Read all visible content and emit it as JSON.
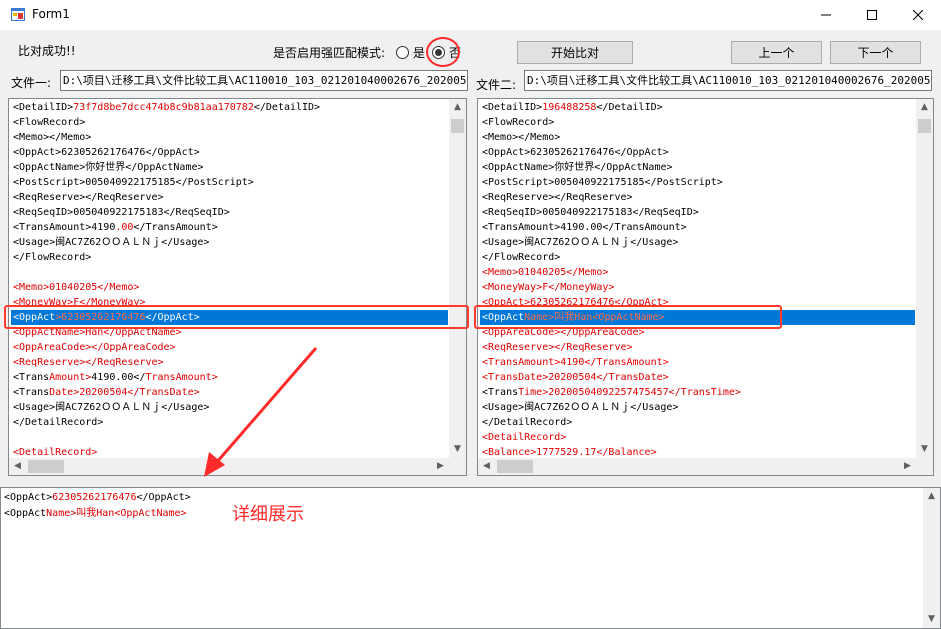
{
  "window": {
    "title": "Form1"
  },
  "status": {
    "message": "比对成功!!"
  },
  "mode": {
    "label": "是否启用强匹配模式:",
    "yes_label": "是",
    "no_label": "否",
    "selected": "否"
  },
  "buttons": {
    "start": "开始比对",
    "prev": "上一个",
    "next": "下一个"
  },
  "file1": {
    "label": "文件一:",
    "path": "D:\\项目\\迁移工具\\文件比较工具\\AC110010_103_021201040002676_20200504"
  },
  "file2": {
    "label": "文件二:",
    "path": "D:\\项目\\迁移工具\\文件比较工具\\AC110010_103_021201040002676_20200504"
  },
  "left_pane": {
    "selected_index": 14,
    "lines": [
      [
        {
          "t": "<DetailID>"
        },
        {
          "t": "73f7d8be7dcc474b8c9b81aa170782",
          "r": true
        },
        {
          "t": "</DetailID>"
        }
      ],
      [
        {
          "t": "<FlowRecord>"
        }
      ],
      [
        {
          "t": "<Memo></Memo>"
        }
      ],
      [
        {
          "t": "<OppAct>62305262176476</OppAct>"
        }
      ],
      [
        {
          "t": "<OppActName>你好世界</OppActName>"
        }
      ],
      [
        {
          "t": "<PostScript>005040922175185</PostScript>"
        }
      ],
      [
        {
          "t": "<ReqReserve></ReqReserve>"
        }
      ],
      [
        {
          "t": "<ReqSeqID>005040922175183</ReqSeqID>"
        }
      ],
      [
        {
          "t": "<TransAmount>4190"
        },
        {
          "t": ".00",
          "r": true
        },
        {
          "t": "</TransAmount>"
        }
      ],
      [
        {
          "t": "<Usage>闽AC7Z62ＯＯＡＬＮｊ</Usage>"
        }
      ],
      [
        {
          "t": "</FlowRecord>"
        }
      ],
      [
        {
          "t": ""
        }
      ],
      [
        {
          "t": "<Memo>01040205</Memo>",
          "r": true
        }
      ],
      [
        {
          "t": "<MoneyWay>F</MoneyWay>",
          "r": true
        }
      ],
      [
        {
          "t": "<OppAct"
        },
        {
          "t": ">62305262176476",
          "r": true
        },
        {
          "t": "</OppAct>"
        }
      ],
      [
        {
          "t": "<OppActName>Han</OppActName>",
          "r": true
        }
      ],
      [
        {
          "t": "<OppAreaCode></OppAreaCode>",
          "r": true
        }
      ],
      [
        {
          "t": "<ReqReserve></ReqReserve>",
          "r": true
        }
      ],
      [
        {
          "t": "<Trans"
        },
        {
          "t": "Amount>",
          "r": true
        },
        {
          "t": "4190.00</"
        },
        {
          "t": "TransAmount>",
          "r": true
        }
      ],
      [
        {
          "t": "<Trans"
        },
        {
          "t": "Date>20200504</TransDate>",
          "r": true
        }
      ],
      [
        {
          "t": "<Usage>闽AC7Z62ＯＯＡＬＮｊ</Usage>"
        }
      ],
      [
        {
          "t": "</DetailRecord>"
        }
      ],
      [
        {
          "t": ""
        }
      ],
      [
        {
          "t": "<DetailRecord>",
          "r": true
        }
      ]
    ]
  },
  "right_pane": {
    "selected_index": 14,
    "lines": [
      [
        {
          "t": "<DetailID>"
        },
        {
          "t": "196488258",
          "r": true
        },
        {
          "t": "</DetailID>"
        }
      ],
      [
        {
          "t": "<FlowRecord>"
        }
      ],
      [
        {
          "t": "<Memo></Memo>"
        }
      ],
      [
        {
          "t": "<OppAct>62305262176476</OppAct>"
        }
      ],
      [
        {
          "t": "<OppActName>你好世界</OppActName>"
        }
      ],
      [
        {
          "t": "<PostScript>005040922175185</PostScript>"
        }
      ],
      [
        {
          "t": "<ReqReserve></ReqReserve>"
        }
      ],
      [
        {
          "t": "<ReqSeqID>005040922175183</ReqSeqID>"
        }
      ],
      [
        {
          "t": "<TransAmount>4190.00</TransAmount>"
        }
      ],
      [
        {
          "t": "<Usage>闽AC7Z62ＯＯＡＬＮｊ</Usage>"
        }
      ],
      [
        {
          "t": "</FlowRecord>"
        }
      ],
      [
        {
          "t": "<Memo>01040205</Memo>",
          "r": true
        }
      ],
      [
        {
          "t": "<MoneyWay>F</MoneyWay>",
          "r": true
        }
      ],
      [
        {
          "t": "<OppAct>62305262176476</OppAct>",
          "r": true
        }
      ],
      [
        {
          "t": "<OppAct"
        },
        {
          "t": "Name>叫我Han<OppActName>",
          "r": true
        }
      ],
      [
        {
          "t": "<OppAreaCode></OppAreaCode>",
          "r": true
        }
      ],
      [
        {
          "t": "<ReqReserve></ReqReserve>",
          "r": true
        }
      ],
      [
        {
          "t": "<TransAmount>4190</TransAmount>",
          "r": true
        }
      ],
      [
        {
          "t": "<TransDate>20200504</TransDate>",
          "r": true
        }
      ],
      [
        {
          "t": "<Trans"
        },
        {
          "t": "Time>20200504092257475457</TransTime>",
          "r": true
        }
      ],
      [
        {
          "t": "<Usage>闽AC7Z62ＯＯＡＬＮｊ</Usage>"
        }
      ],
      [
        {
          "t": "</DetailRecord>"
        }
      ],
      [
        {
          "t": "<DetailRecord>",
          "r": true
        }
      ],
      [
        {
          "t": "<Balance>1777529.17</Balance>",
          "r": true
        }
      ]
    ]
  },
  "detail": {
    "lines": [
      [
        {
          "t": "<OppAct>"
        },
        {
          "t": "62305262176476",
          "r": true
        },
        {
          "t": "</OppAct>"
        }
      ],
      [
        {
          "t": "<OppAct"
        },
        {
          "t": "Name>叫我Han<OppActName>",
          "r": true
        }
      ]
    ],
    "annotation": "详细展示"
  },
  "colors": {
    "selection": "#0078d7",
    "diff_text": "#e00000",
    "annotation": "#ff2a2a"
  }
}
